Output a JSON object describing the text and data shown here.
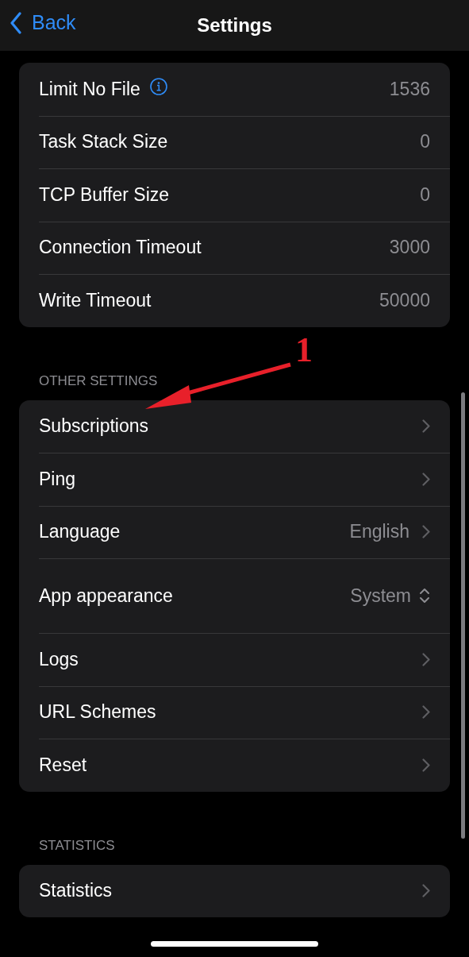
{
  "nav": {
    "back": "Back",
    "title": "Settings"
  },
  "sections": [
    {
      "rows": [
        {
          "label": "Limit No File",
          "info": true,
          "kind": "value",
          "value": "1536"
        },
        {
          "label": "Task Stack Size",
          "info": false,
          "kind": "value",
          "value": "0"
        },
        {
          "label": "TCP Buffer Size",
          "info": false,
          "kind": "value",
          "value": "0"
        },
        {
          "label": "Connection Timeout",
          "info": false,
          "kind": "value",
          "value": "3000"
        },
        {
          "label": "Write Timeout",
          "info": false,
          "kind": "value",
          "value": "50000"
        }
      ]
    },
    {
      "header": "OTHER SETTINGS",
      "rows": [
        {
          "label": "Subscriptions",
          "info": false,
          "kind": "chevron"
        },
        {
          "label": "Ping",
          "info": false,
          "kind": "chevron"
        },
        {
          "label": "Language",
          "info": false,
          "kind": "value_chevron",
          "value": "English"
        },
        {
          "label": "App appearance",
          "info": false,
          "kind": "picker",
          "value": "System"
        },
        {
          "label": "Logs",
          "info": false,
          "kind": "chevron"
        },
        {
          "label": "URL Schemes",
          "info": false,
          "kind": "chevron"
        },
        {
          "label": "Reset",
          "info": false,
          "kind": "chevron"
        }
      ]
    },
    {
      "header": "STATISTICS",
      "rows": [
        {
          "label": "Statistics",
          "info": false,
          "kind": "chevron"
        }
      ]
    }
  ],
  "annotation": {
    "label": "1"
  }
}
